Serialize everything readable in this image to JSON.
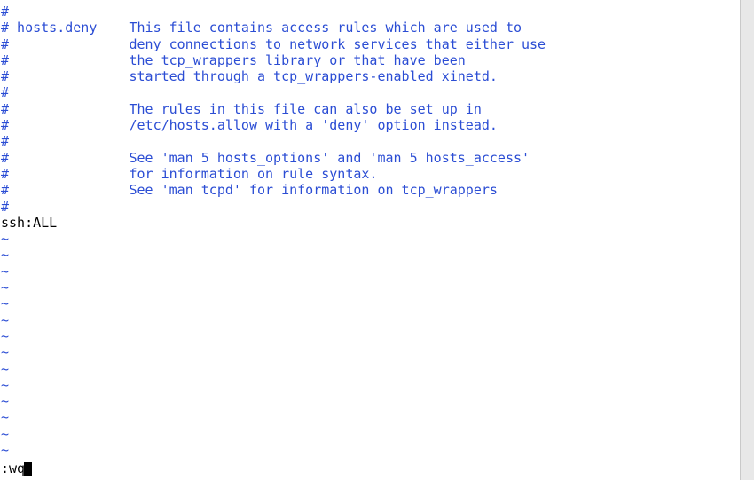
{
  "editor": {
    "lines": {
      "l00": "#",
      "l01": "# hosts.deny    This file contains access rules which are used to",
      "l02": "#               deny connections to network services that either use",
      "l03": "#               the tcp_wrappers library or that have been",
      "l04": "#               started through a tcp_wrappers-enabled xinetd.",
      "l05": "#",
      "l06": "#               The rules in this file can also be set up in",
      "l07": "#               /etc/hosts.allow with a 'deny' option instead.",
      "l08": "#",
      "l09": "#               See 'man 5 hosts_options' and 'man 5 hosts_access'",
      "l10": "#               for information on rule syntax.",
      "l11": "#               See 'man tcpd' for information on tcp_wrappers",
      "l12": "#",
      "l13": "ssh:ALL"
    },
    "tilde": "~",
    "command": ":wq"
  }
}
